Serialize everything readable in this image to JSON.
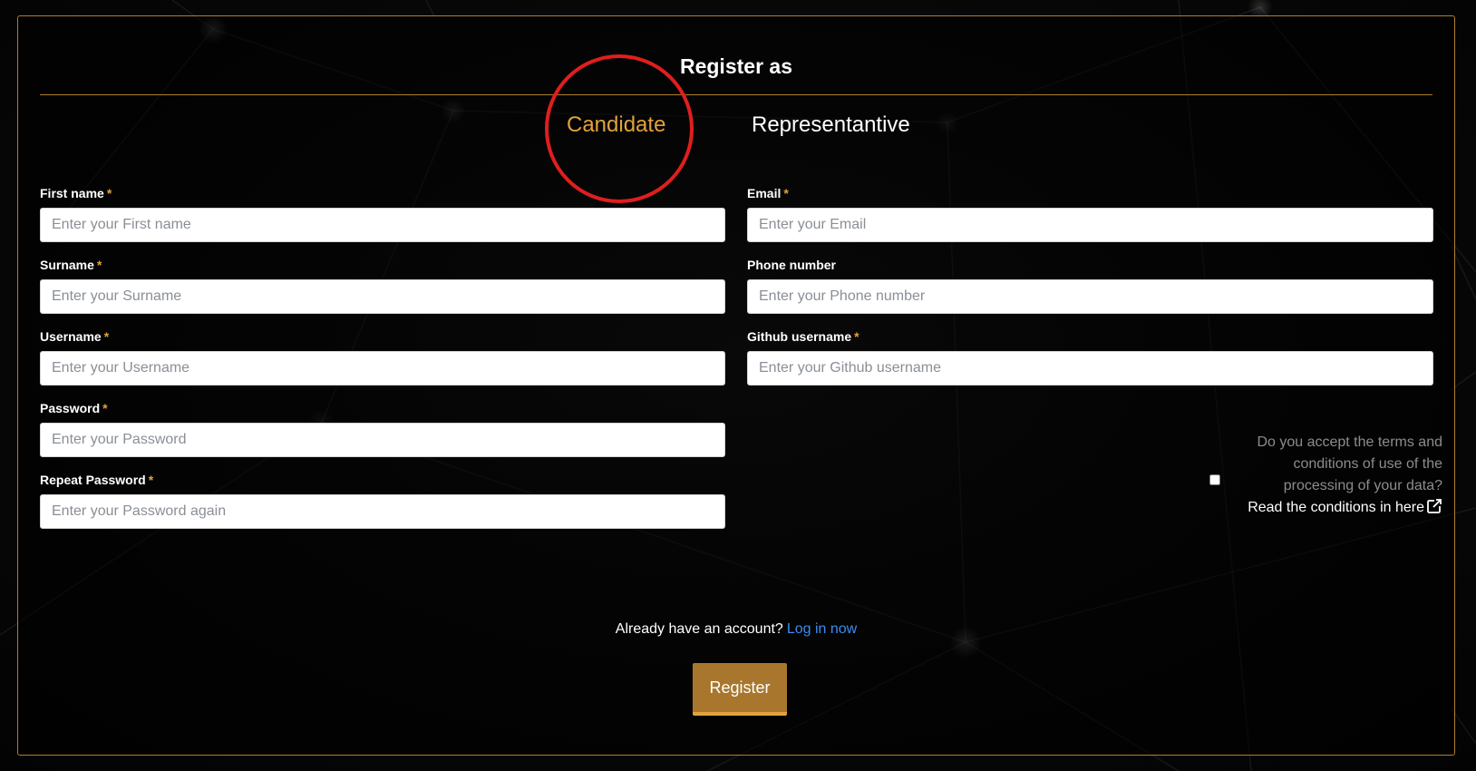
{
  "form": {
    "title": "Register as",
    "tabs": [
      {
        "label": "Candidate",
        "active": true
      },
      {
        "label": "Representantive",
        "active": false
      }
    ],
    "required_marker": "*",
    "fields": {
      "first_name": {
        "label": "First name",
        "placeholder": "Enter your First name",
        "value": "",
        "required": true
      },
      "surname": {
        "label": "Surname",
        "placeholder": "Enter your Surname",
        "value": "",
        "required": true
      },
      "username": {
        "label": "Username",
        "placeholder": "Enter your Username",
        "value": "",
        "required": true
      },
      "password": {
        "label": "Password",
        "placeholder": "Enter your Password",
        "value": "",
        "required": true
      },
      "repeat_password": {
        "label": "Repeat Password",
        "placeholder": "Enter your Password again",
        "value": "",
        "required": true
      },
      "email": {
        "label": "Email",
        "placeholder": "Enter your Email",
        "value": "",
        "required": true
      },
      "phone": {
        "label": "Phone number",
        "placeholder": "Enter your Phone number",
        "value": "",
        "required": false
      },
      "github": {
        "label": "Github username",
        "placeholder": "Enter your Github username",
        "value": "",
        "required": true
      }
    },
    "terms": {
      "question_lines": [
        "Do you accept the terms and",
        "conditions of use of the",
        "processing of your data?"
      ],
      "link_label": "Read the conditions in here",
      "link_icon": "external-link-icon",
      "checked": false
    },
    "login": {
      "prompt": "Already have an account?",
      "link_label": "Log in now"
    },
    "submit_label": "Register"
  },
  "colors": {
    "accent": "#e2a23c",
    "border": "#b07e2a",
    "button": "#a8772d",
    "link": "#3b8cf0",
    "annotation": "#e01e1e"
  }
}
